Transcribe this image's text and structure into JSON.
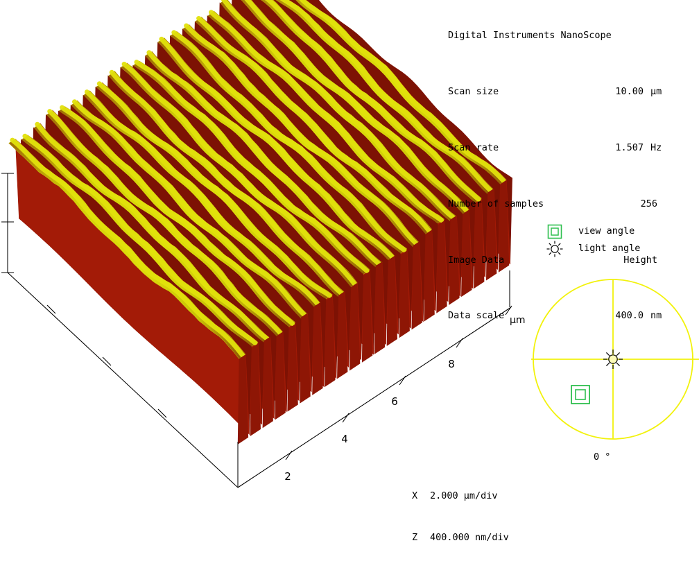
{
  "header": {
    "title": "Digital Instruments NanoScope",
    "params": [
      {
        "label": "Scan size",
        "value": "10.00",
        "unit": "µm"
      },
      {
        "label": "Scan rate",
        "value": "1.507",
        "unit": "Hz"
      },
      {
        "label": "Number of samples",
        "value": "256",
        "unit": ""
      },
      {
        "label": "Image Data",
        "value": "Height",
        "unit": ""
      },
      {
        "label": "Data scale",
        "value": "400.0",
        "unit": "nm"
      }
    ]
  },
  "plot": {
    "x_axis": {
      "unit_label": "µm",
      "ticks": [
        "2",
        "4",
        "6",
        "8"
      ]
    },
    "scale_legend": [
      {
        "axis": "X",
        "value": "2.000 µm/div"
      },
      {
        "axis": "Z",
        "value": "400.000 nm/div"
      }
    ],
    "colors": {
      "ridge_high": "#d8d607",
      "ridge_mid": "#c3bd06",
      "groove_low": "#8d1506",
      "groove_dark": "#6e1004"
    }
  },
  "angle_legend": {
    "items": [
      {
        "icon": "view-angle-marker-icon",
        "label": "view angle"
      },
      {
        "icon": "light-angle-sun-icon",
        "label": "light angle"
      }
    ]
  },
  "compass": {
    "angle_label": "0 °",
    "circle_color": "#f2f20d",
    "view_marker_color": "#2fbf4f",
    "light_marker_color": "#000000"
  }
}
